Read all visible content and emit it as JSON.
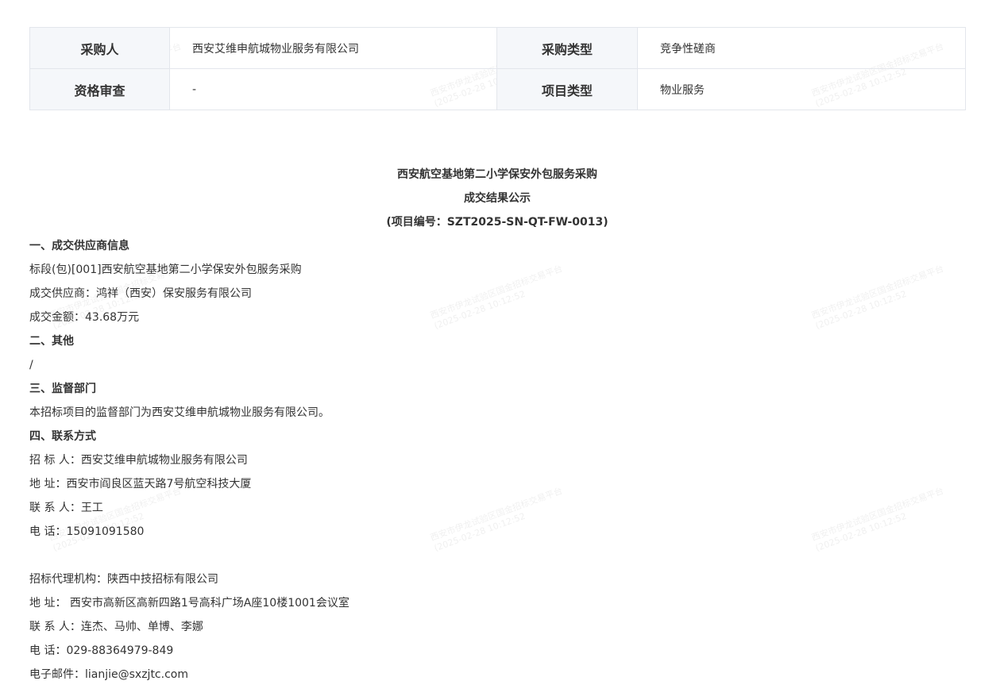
{
  "info_table": {
    "rows": [
      {
        "label1": "采购人",
        "value1": "西安艾维申航城物业服务有限公司",
        "label2": "采购类型",
        "value2": "竞争性磋商"
      },
      {
        "label1": "资格审查",
        "value1": "-",
        "label2": "项目类型",
        "value2": "物业服务"
      }
    ]
  },
  "notice": {
    "title_line1": "西安航空基地第二小学保安外包服务采购",
    "title_line2": "成交结果公示",
    "title_line3": "(项目编号：SZT2025-SN-QT-FW-0013)",
    "lines": [
      "一、成交供应商信息",
      "标段(包)[001]西安航空基地第二小学保安外包服务采购",
      "成交供应商：鸿祥（西安）保安服务有限公司",
      "成交金额：43.68万元",
      "二、其他",
      "/",
      "三、监督部门",
      "本招标项目的监督部门为西安艾维申航城物业服务有限公司。",
      "四、联系方式",
      "招 标 人：西安艾维申航城物业服务有限公司",
      "地 址：西安市阎良区蓝天路7号航空科技大厦",
      "联 系 人：王工",
      "电 话：15091091580",
      "",
      "招标代理机构：陕西中技招标有限公司",
      "地 址： 西安市高新区高新四路1号高科广场A座10楼1001会议室",
      "联 系 人：连杰、马帅、单博、李娜",
      "电 话：029-88364979-849",
      "电子邮件：lianjie@sxzjtc.com"
    ]
  },
  "watermark": {
    "line1": "西安市伊龙试验区国金招标交易平台",
    "line2": "(2025-02-28 10:12:52"
  }
}
